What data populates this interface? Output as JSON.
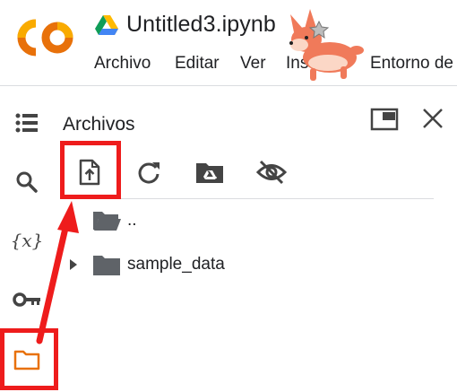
{
  "header": {
    "logo_text": "CO",
    "notebook_title": "Untitled3.ipynb",
    "drive_icon": "google-drive-icon",
    "menu": [
      "Archivo",
      "Editar",
      "Ver",
      "Insertar",
      "Entorno de"
    ],
    "mascot": "corgi-mascot"
  },
  "left_rail": {
    "items": [
      {
        "name": "table-of-contents",
        "icon": "list-icon"
      },
      {
        "name": "search",
        "icon": "search-icon"
      },
      {
        "name": "variables",
        "icon": "variables-icon",
        "glyph": "{x}"
      },
      {
        "name": "secrets",
        "icon": "key-icon"
      },
      {
        "name": "files",
        "icon": "folder-icon",
        "active": true
      }
    ]
  },
  "files_panel": {
    "title": "Archivos",
    "toolbar": [
      {
        "name": "upload",
        "icon": "file-upload-icon"
      },
      {
        "name": "refresh",
        "icon": "refresh-icon"
      },
      {
        "name": "mount-drive",
        "icon": "drive-folder-icon"
      },
      {
        "name": "toggle-hidden",
        "icon": "eye-off-icon"
      }
    ],
    "rows": [
      {
        "label": "..",
        "expandable": false
      },
      {
        "label": "sample_data",
        "expandable": true
      }
    ]
  },
  "colors": {
    "brand_orange": "#F9AB00",
    "brand_dark_orange": "#E8710A",
    "icon_gray": "#5f6368",
    "folder_gray": "#5f6368",
    "highlight_red": "#EE1C1C",
    "active_files_orange": "#E8710A"
  }
}
